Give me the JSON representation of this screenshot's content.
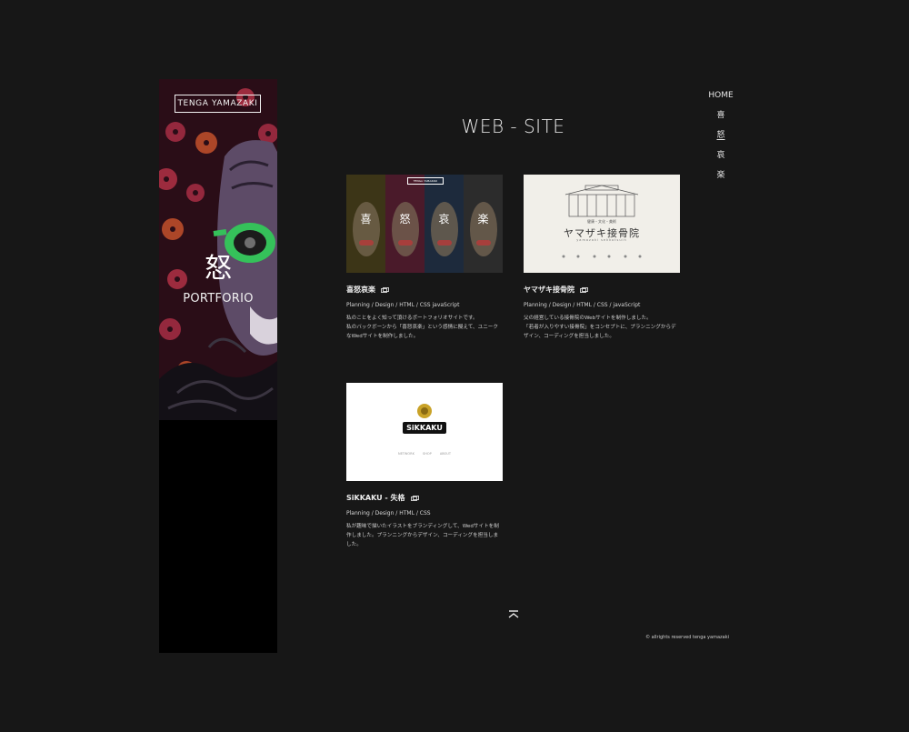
{
  "sidebar": {
    "logo": "TENGA YAMAZAKI",
    "kanji": "怒",
    "subtitle": "PORTFORIO"
  },
  "nav": {
    "items": [
      "HOME",
      "喜",
      "怒",
      "哀",
      "楽"
    ]
  },
  "page_title": "WEB - SITE",
  "works": [
    {
      "title": "喜怒哀楽",
      "tags": "Planning / Design / HTML / CSS javaScript",
      "description": "私のことをよく知って頂けるポートフォリオサイトです。\n私のバックボーンから「喜怒哀楽」という感情に擬えて、ユニークなWedサイトを制作しました。",
      "thumb": {
        "logo": "TENGA YAMAZAKI",
        "labels": [
          "喜",
          "怒",
          "哀",
          "楽"
        ]
      }
    },
    {
      "title": "ヤマザキ接骨院",
      "tags": "Planning / Design / HTML / CSS / javaScript",
      "description": "父の経営している接骨院のWebサイトを制作しました。\n「若者が入りやすい接骨院」をコンセプトに、プランニングからデザイン、コーディングを担当しました。",
      "thumb": {
        "small": "健康・文化・美術",
        "title": "ヤマザキ接骨院",
        "romaji": "yamazaki sekkotsuin"
      }
    },
    {
      "title": "SiKKAKU - 失格",
      "tags": "Planning / Design / HTML / CSS",
      "description": "私が趣味で描いたイラストをブランディングして、Wedサイトを制作しました。プランニングからデザイン、コーディングを担当しました。",
      "thumb": {
        "brand": "SiKKAKU",
        "nav": "NETWORK SHOP ABOUT"
      }
    }
  ],
  "footer": {
    "copyright": "© allrights reserved tenga yamazaki"
  },
  "colors": {
    "background": "#171717",
    "panel": "#000000",
    "text": "#e8e8e8",
    "flower_red": "#c2364b",
    "flower_orange": "#e2632f",
    "glasses_green": "#35c15a"
  }
}
